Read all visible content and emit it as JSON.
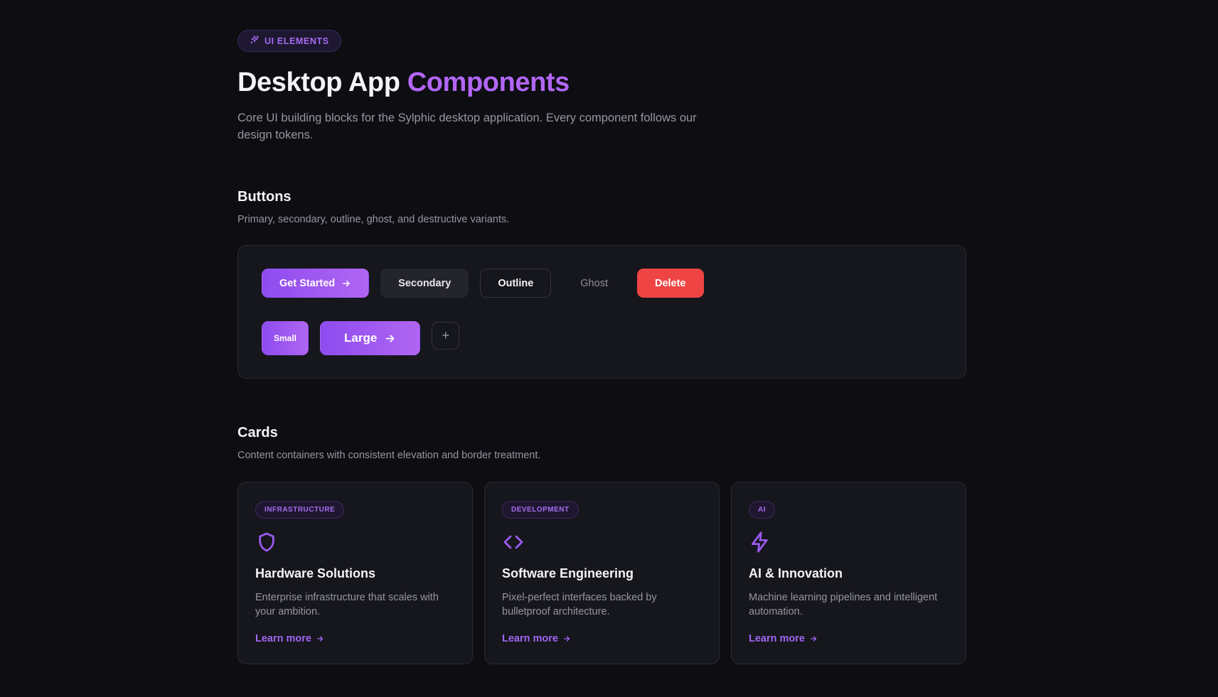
{
  "header": {
    "badge": "UI ELEMENTS",
    "title_main": "Desktop App ",
    "title_accent": "Components",
    "subtitle": "Core UI building blocks for the Sylphic desktop application. Every component follows our design tokens."
  },
  "buttons_section": {
    "title": "Buttons",
    "description": "Primary, secondary, outline, ghost, and destructive variants.",
    "row1": {
      "primary": "Get Started",
      "secondary": "Secondary",
      "outline": "Outline",
      "ghost": "Ghost",
      "destructive": "Delete"
    },
    "row2": {
      "small": "Small",
      "large": "Large",
      "icon": "+"
    }
  },
  "cards_section": {
    "title": "Cards",
    "description": "Content containers with consistent elevation and border treatment.",
    "cards": [
      {
        "tag": "INFRASTRUCTURE",
        "icon": "shield-icon",
        "title": "Hardware Solutions",
        "description": "Enterprise infrastructure that scales with your ambition.",
        "link": "Learn more"
      },
      {
        "tag": "DEVELOPMENT",
        "icon": "code-icon",
        "title": "Software Engineering",
        "description": "Pixel-perfect interfaces backed by bulletproof architecture.",
        "link": "Learn more"
      },
      {
        "tag": "AI",
        "icon": "lightning-icon",
        "title": "AI & Innovation",
        "description": "Machine learning pipelines and intelligent automation.",
        "link": "Learn more"
      }
    ]
  },
  "colors": {
    "background": "#0d0d12",
    "accent": "#b266f5",
    "danger": "#ef4444"
  }
}
